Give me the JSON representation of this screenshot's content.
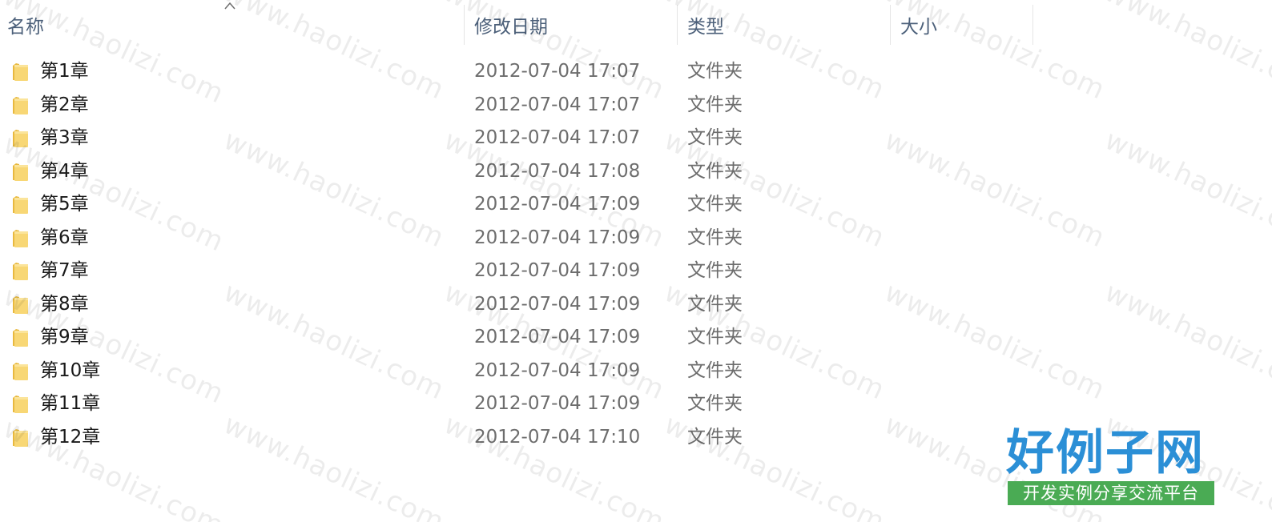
{
  "columns": {
    "name": "名称",
    "date": "修改日期",
    "type": "类型",
    "size": "大小"
  },
  "sort": {
    "column": "name",
    "direction": "ascending",
    "icon": "sort-up-arrow-icon"
  },
  "files": [
    {
      "name": "第1章",
      "date": "2012-07-04 17:07",
      "type": "文件夹",
      "size": "",
      "icon": "folder-icon"
    },
    {
      "name": "第2章",
      "date": "2012-07-04 17:07",
      "type": "文件夹",
      "size": "",
      "icon": "folder-icon"
    },
    {
      "name": "第3章",
      "date": "2012-07-04 17:07",
      "type": "文件夹",
      "size": "",
      "icon": "folder-icon"
    },
    {
      "name": "第4章",
      "date": "2012-07-04 17:08",
      "type": "文件夹",
      "size": "",
      "icon": "folder-icon"
    },
    {
      "name": "第5章",
      "date": "2012-07-04 17:09",
      "type": "文件夹",
      "size": "",
      "icon": "folder-icon"
    },
    {
      "name": "第6章",
      "date": "2012-07-04 17:09",
      "type": "文件夹",
      "size": "",
      "icon": "folder-icon"
    },
    {
      "name": "第7章",
      "date": "2012-07-04 17:09",
      "type": "文件夹",
      "size": "",
      "icon": "folder-icon"
    },
    {
      "name": "第8章",
      "date": "2012-07-04 17:09",
      "type": "文件夹",
      "size": "",
      "icon": "folder-icon"
    },
    {
      "name": "第9章",
      "date": "2012-07-04 17:09",
      "type": "文件夹",
      "size": "",
      "icon": "folder-icon"
    },
    {
      "name": "第10章",
      "date": "2012-07-04 17:09",
      "type": "文件夹",
      "size": "",
      "icon": "folder-icon"
    },
    {
      "name": "第11章",
      "date": "2012-07-04 17:09",
      "type": "文件夹",
      "size": "",
      "icon": "folder-icon"
    },
    {
      "name": "第12章",
      "date": "2012-07-04 17:10",
      "type": "文件夹",
      "size": "",
      "icon": "folder-icon"
    }
  ],
  "watermark": {
    "text": "www.haolizi.com"
  },
  "logo": {
    "main": "好例子网",
    "sub": "开发实例分享交流平台",
    "main_color": "#2b8fd6",
    "sub_bg_color": "#4aab54"
  },
  "colors": {
    "header_text": "#4c607a",
    "name_text": "#1a1a1a",
    "meta_text": "#6d6d6d",
    "folder_yellow": "#f8d775"
  }
}
